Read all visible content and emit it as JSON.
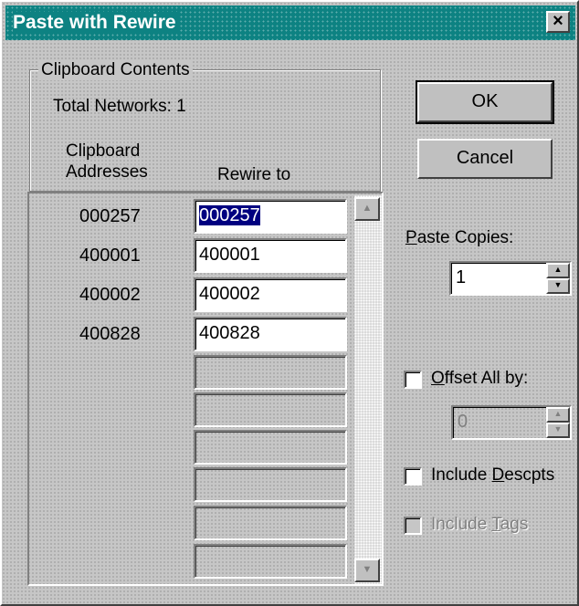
{
  "window": {
    "title": "Paste with Rewire",
    "close_glyph": "×"
  },
  "clipboard": {
    "group_title": "Clipboard Contents",
    "total_networks": "Total Networks: 1",
    "col_addresses_line1": "Clipboard",
    "col_addresses_line2": "Addresses",
    "col_rewire": "Rewire to",
    "rows": [
      {
        "address": "000257",
        "rewire": "000257",
        "selected": true
      },
      {
        "address": "400001",
        "rewire": "400001"
      },
      {
        "address": "400002",
        "rewire": "400002"
      },
      {
        "address": "400828",
        "rewire": "400828"
      },
      {
        "address": "",
        "rewire": ""
      },
      {
        "address": "",
        "rewire": ""
      },
      {
        "address": "",
        "rewire": ""
      },
      {
        "address": "",
        "rewire": ""
      },
      {
        "address": "",
        "rewire": ""
      },
      {
        "address": "",
        "rewire": ""
      }
    ]
  },
  "buttons": {
    "ok": "OK",
    "cancel": "Cancel"
  },
  "paste_copies": {
    "label_u": "P",
    "label_rest": "aste Copies:",
    "value": "1"
  },
  "offset": {
    "label_u": "O",
    "label_rest": "ffset All by:",
    "value": "0",
    "checked": false
  },
  "include_descpts": {
    "label_pre": "Include ",
    "label_u": "D",
    "label_rest": "escpts",
    "checked": false
  },
  "include_tags": {
    "label_pre": "Include ",
    "label_u": "T",
    "label_rest": "ags",
    "checked": false,
    "disabled": true
  },
  "icons": {
    "scroll_up": "▲",
    "scroll_down": "▼",
    "spin_up": "▲",
    "spin_down": "▼"
  }
}
